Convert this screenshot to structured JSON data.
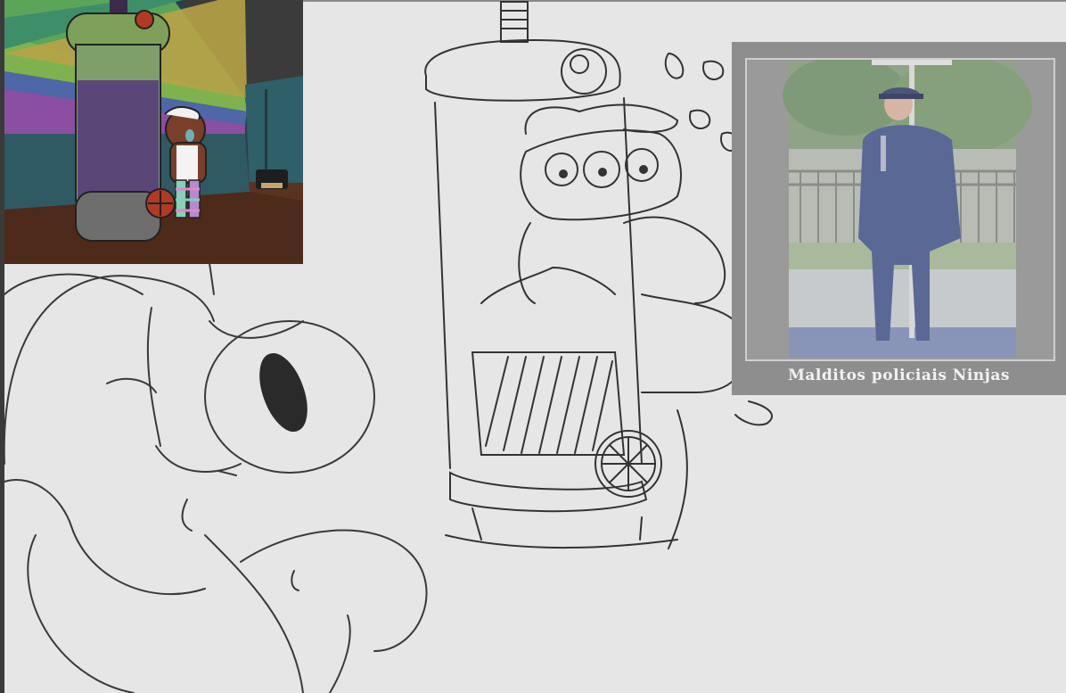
{
  "canvas": {
    "background": "#e6e6e6",
    "frame_color": "#2b2b2b"
  },
  "references": {
    "cartoon": {
      "icon": "cartoon-reference-image"
    },
    "meme": {
      "caption": "Malditos policiais Ninjas",
      "icon": "meme-reference-photo"
    }
  },
  "sketches": {
    "head": {
      "icon": "character-head-sketch"
    },
    "tank": {
      "icon": "tank-character-sketch"
    }
  }
}
